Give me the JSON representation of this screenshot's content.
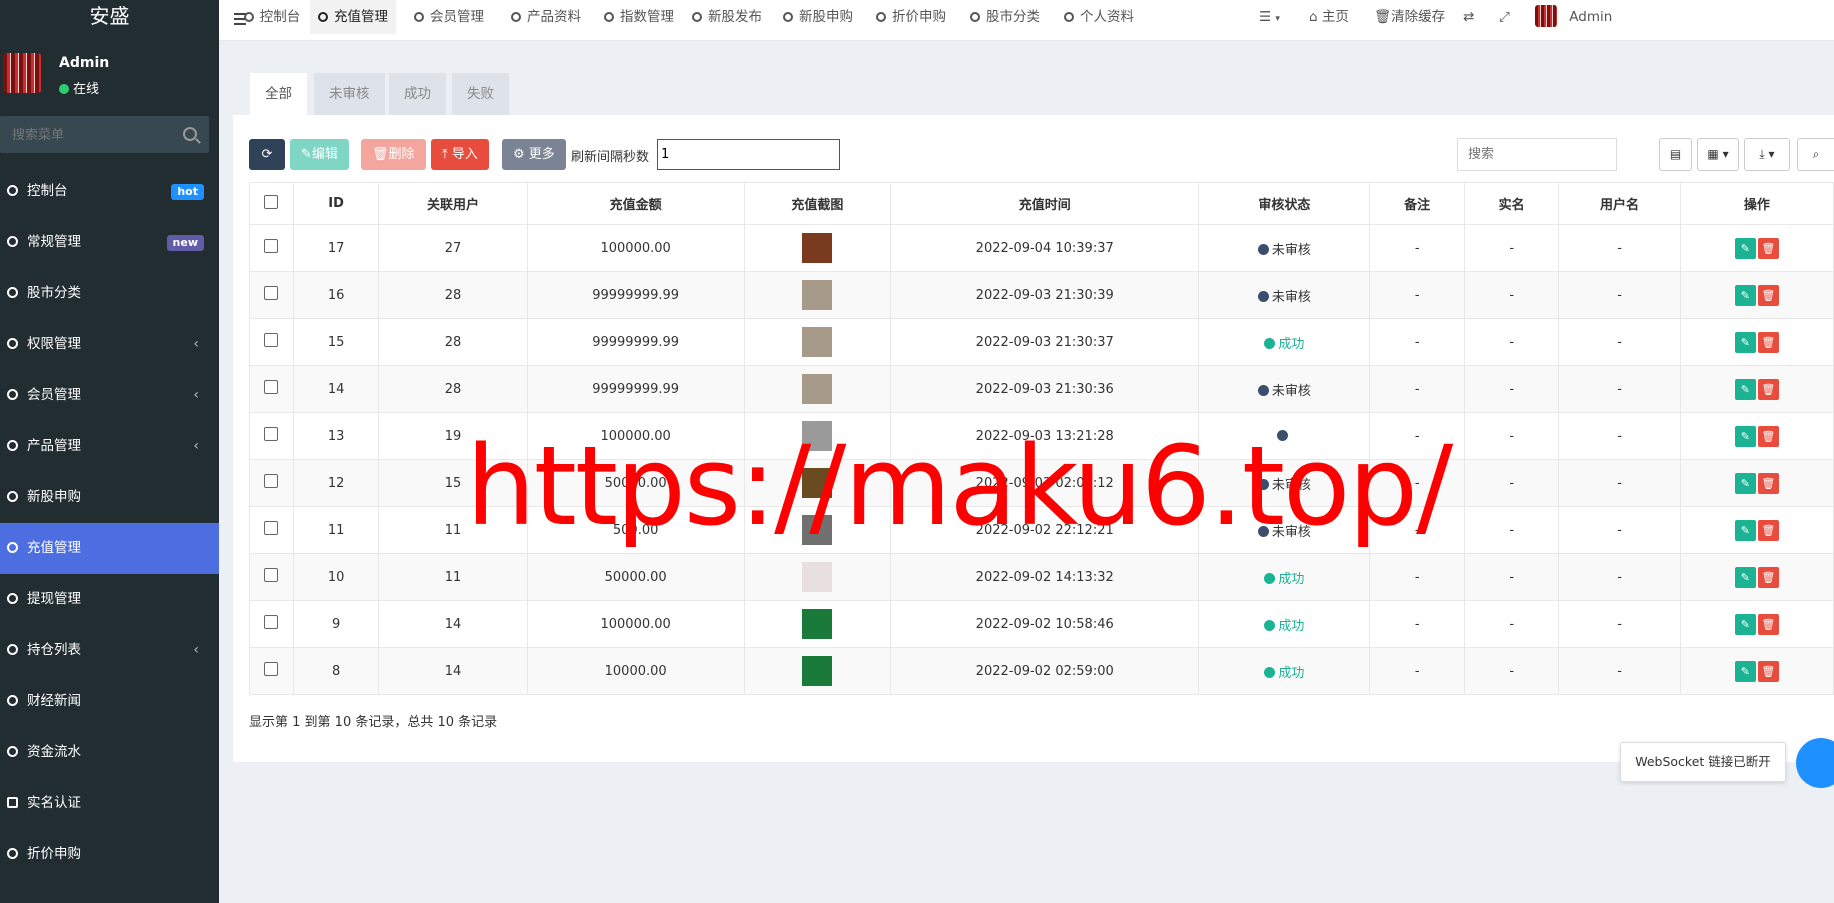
{
  "sidebar": {
    "brand": "安盛",
    "user": {
      "name": "Admin",
      "status": "在线"
    },
    "search_placeholder": "搜索菜单",
    "items": [
      {
        "label": "控制台",
        "icon": "dashboard-icon",
        "badge": "hot"
      },
      {
        "label": "常规管理",
        "icon": "gears-icon",
        "badge": "new"
      },
      {
        "label": "股市分类",
        "icon": "leaf-icon"
      },
      {
        "label": "权限管理",
        "icon": "users-icon",
        "arrow": "‹"
      },
      {
        "label": "会员管理",
        "icon": "user-circle-icon",
        "arrow": "‹"
      },
      {
        "label": "产品管理",
        "icon": "circle-icon",
        "arrow": "‹"
      },
      {
        "label": "新股申购",
        "icon": "circle-icon"
      },
      {
        "label": "充值管理",
        "icon": "circle-icon",
        "active": true
      },
      {
        "label": "提现管理",
        "icon": "circle-icon"
      },
      {
        "label": "持仓列表",
        "icon": "circle-icon",
        "arrow": "‹"
      },
      {
        "label": "财经新闻",
        "icon": "circle-icon"
      },
      {
        "label": "资金流水",
        "icon": "circle-icon"
      },
      {
        "label": "实名认证",
        "icon": "credit-card-icon"
      },
      {
        "label": "折价申购",
        "icon": "circle-icon"
      }
    ]
  },
  "topnav": {
    "tabs": [
      {
        "label": "控制台",
        "icon": "dashboard-icon"
      },
      {
        "label": "充值管理",
        "icon": "circle-icon",
        "active": true
      },
      {
        "label": "会员管理",
        "icon": "user-icon"
      },
      {
        "label": "产品资料",
        "icon": "circle-icon"
      },
      {
        "label": "指数管理",
        "icon": "circle-icon"
      },
      {
        "label": "新股发布",
        "icon": "circle-icon"
      },
      {
        "label": "新股申购",
        "icon": "circle-icon"
      },
      {
        "label": "折价申购",
        "icon": "circle-icon"
      },
      {
        "label": "股市分类",
        "icon": "leaf-icon"
      },
      {
        "label": "个人资料",
        "icon": "user-icon"
      }
    ],
    "right": {
      "home": "主页",
      "clear_cache": "清除缓存",
      "admin": "Admin"
    }
  },
  "filter_tabs": [
    "全部",
    "未审核",
    "成功",
    "失败"
  ],
  "toolbar": {
    "edit": "编辑",
    "delete": "删除",
    "import": "导入",
    "more": "更多",
    "refresh_label": "刷新间隔秒数",
    "refresh_value": "1",
    "search_placeholder": "搜索"
  },
  "table": {
    "columns": [
      "ID",
      "关联用户",
      "充值金额",
      "充值截图",
      "充值时间",
      "审核状态",
      "备注",
      "实名",
      "用户名",
      "操作"
    ],
    "rows": [
      {
        "id": "17",
        "user": "27",
        "amount": "100000.00",
        "thumb": "#7a3a20",
        "time": "2022-09-04 10:39:37",
        "status": "未审核",
        "note": "-",
        "realname": "-",
        "username": "-"
      },
      {
        "id": "16",
        "user": "28",
        "amount": "99999999.99",
        "thumb": "#a89a88",
        "time": "2022-09-03 21:30:39",
        "status": "未审核",
        "note": "-",
        "realname": "-",
        "username": "-"
      },
      {
        "id": "15",
        "user": "28",
        "amount": "99999999.99",
        "thumb": "#a89a88",
        "time": "2022-09-03 21:30:37",
        "status": "成功",
        "note": "-",
        "realname": "-",
        "username": "-"
      },
      {
        "id": "14",
        "user": "28",
        "amount": "99999999.99",
        "thumb": "#a89a88",
        "time": "2022-09-03 21:30:36",
        "status": "未审核",
        "note": "-",
        "realname": "-",
        "username": "-"
      },
      {
        "id": "13",
        "user": "19",
        "amount": "100000.00",
        "thumb": "#9a9a9a",
        "time": "2022-09-03 13:21:28",
        "status": "",
        "note": "-",
        "realname": "-",
        "username": "-"
      },
      {
        "id": "12",
        "user": "15",
        "amount": "50000.00",
        "thumb": "#6a4a20",
        "time": "2022-09-03 02:05:12",
        "status": "未审核",
        "note": "-",
        "realname": "-",
        "username": "-"
      },
      {
        "id": "11",
        "user": "11",
        "amount": "500.00",
        "thumb": "#707070",
        "time": "2022-09-02 22:12:21",
        "status": "未审核",
        "note": "-",
        "realname": "-",
        "username": "-"
      },
      {
        "id": "10",
        "user": "11",
        "amount": "50000.00",
        "thumb": "#e8e0e0",
        "time": "2022-09-02 14:13:32",
        "status": "成功",
        "note": "-",
        "realname": "-",
        "username": "-"
      },
      {
        "id": "9",
        "user": "14",
        "amount": "100000.00",
        "thumb": "#1a7a3a",
        "time": "2022-09-02 10:58:46",
        "status": "成功",
        "note": "-",
        "realname": "-",
        "username": "-"
      },
      {
        "id": "8",
        "user": "14",
        "amount": "10000.00",
        "thumb": "#1a7a3a",
        "time": "2022-09-02 02:59:00",
        "status": "成功",
        "note": "-",
        "realname": "-",
        "username": "-"
      }
    ]
  },
  "footer": "显示第 1 到第 10 条记录，总共 10 条记录",
  "websocket_toast": "WebSocket 链接已断开",
  "watermark": "https://maku6.top/",
  "colors": {
    "sidebar_bg": "#222d32",
    "active": "#4c6ee0",
    "success": "#1bb393",
    "danger": "#e74c3c"
  }
}
